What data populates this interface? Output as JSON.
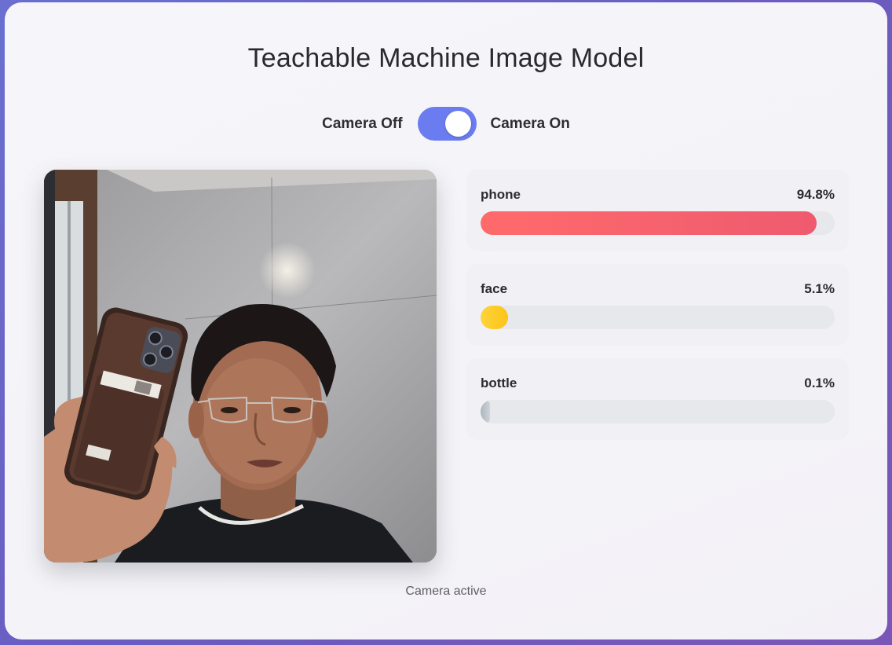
{
  "app": {
    "title": "Teachable Machine Image Model"
  },
  "camera_toggle": {
    "off_label": "Camera Off",
    "on_label": "Camera On",
    "state": "on",
    "accent": "#6b7cf0"
  },
  "predictions": [
    {
      "label": "phone",
      "percent_text": "94.8%",
      "value": 0.948,
      "color": "#ff6b6b"
    },
    {
      "label": "face",
      "percent_text": "5.1%",
      "value": 0.051,
      "color": "#fcc419"
    },
    {
      "label": "bottle",
      "percent_text": "0.1%",
      "value": 0.001,
      "color": "#adb5bd"
    }
  ],
  "status": {
    "text": "Camera active"
  }
}
